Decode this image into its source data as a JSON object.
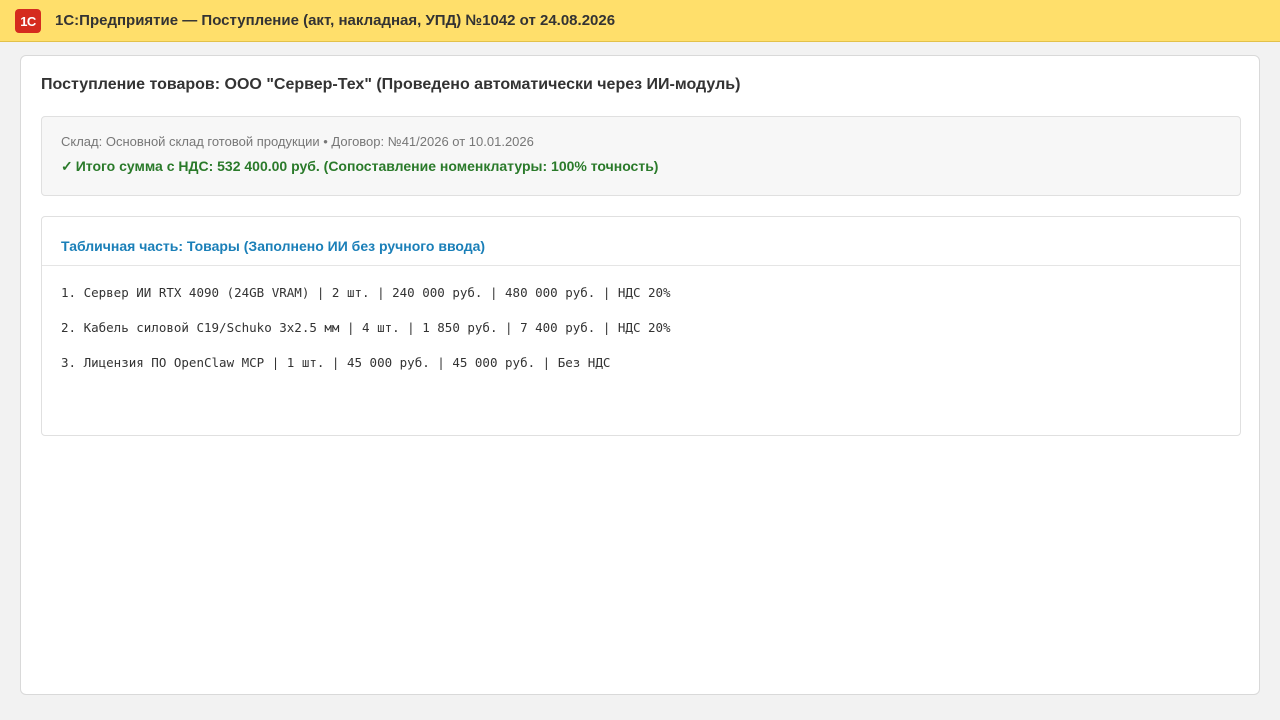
{
  "window": {
    "logo_text": "1С",
    "title": "1С:Предприятие — Поступление (акт, накладная, УПД) №1042 от 24.08.2026"
  },
  "document": {
    "heading": "Поступление товаров: ООО \"Сервер-Тех\" (Проведено автоматически через ИИ-модуль)",
    "info": {
      "meta": "Склад: Основной склад готовой продукции • Договор: №41/2026 от 10.01.2026",
      "check_icon": "✓",
      "total": "Итого сумма с НДС: 532 400.00 руб. (Сопоставление номенклатуры: 100% точность)"
    },
    "goods": {
      "title": "Табличная часть: Товары (Заполнено ИИ без ручного ввода)",
      "rows": [
        "1. Сервер ИИ RTX 4090 (24GB VRAM) | 2 шт. | 240 000 руб. | 480 000 руб. | НДС 20%",
        "2. Кабель силовой C19/Schuko 3x2.5 мм | 4 шт. | 1 850 руб. | 7 400 руб. | НДС 20%",
        "3. Лицензия ПО OpenClaw MCP | 1 шт. | 45 000 руб. | 45 000 руб. | Без НДС"
      ]
    }
  },
  "colors": {
    "titlebar": "#ffdf6b",
    "logo": "#d52b1e",
    "success": "#2a7a2a",
    "section_title": "#1a7fb8"
  }
}
